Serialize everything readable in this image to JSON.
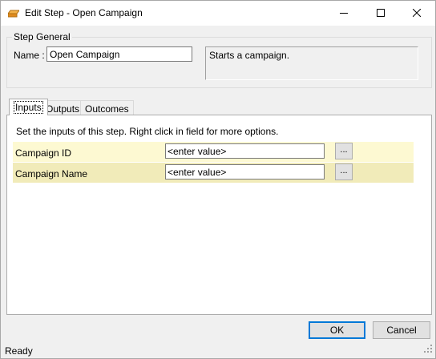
{
  "window": {
    "title": "Edit Step - Open Campaign"
  },
  "step_general": {
    "group_title": "Step General",
    "name_label": "Name :",
    "name_value": "Open Campaign",
    "description": "Starts a campaign."
  },
  "tabs": [
    {
      "label": "Inputs",
      "selected": true
    },
    {
      "label": "Outputs",
      "selected": false
    },
    {
      "label": "Outcomes",
      "selected": false
    }
  ],
  "inputs_panel": {
    "instructions": "Set the inputs of this step.  Right click in field for more options.",
    "rows": [
      {
        "label": "Campaign ID",
        "value": "<enter value>",
        "button": "...",
        "color": "#fdf9d2"
      },
      {
        "label": "Campaign Name",
        "value": "<enter value>",
        "button": "...",
        "color": "#f1ebb9"
      }
    ]
  },
  "buttons": {
    "ok": "OK",
    "cancel": "Cancel"
  },
  "status": {
    "text": "Ready"
  },
  "icons": [
    "app-icon",
    "minimize-icon",
    "maximize-icon",
    "close-icon",
    "size-grip-icon"
  ]
}
